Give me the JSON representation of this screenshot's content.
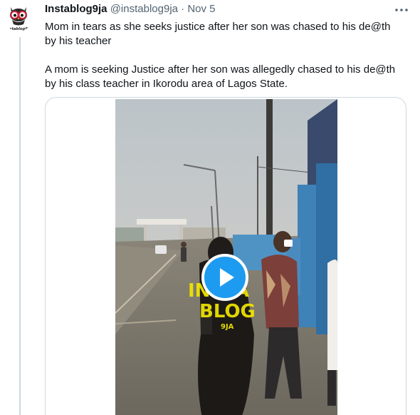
{
  "tweet": {
    "author": {
      "display_name": "Instablog9ja",
      "handle": "@instablog9ja",
      "separator": "·",
      "timestamp": "Nov 5",
      "avatar_caption": "instablog9ja"
    },
    "paragraphs": [
      "Mom in tears as she seeks justice after her son was chased to his de@th by his teacher",
      "A mom is seeking Justice after her son was allegedly chased to his de@th by his class teacher in Ikorodu area of Lagos State."
    ],
    "media": {
      "type": "video",
      "watermark_lines": [
        "INSTA",
        "BLOG",
        "9JA"
      ]
    }
  },
  "icons": {
    "more": "more-horizontal-icon",
    "play": "play-icon",
    "avatar": "owl-glasses-logo"
  },
  "colors": {
    "accent": "#1d9bf0",
    "text_primary": "#0f1419",
    "text_secondary": "#536471",
    "border": "#cfd9de",
    "watermark": "#f2e600"
  }
}
